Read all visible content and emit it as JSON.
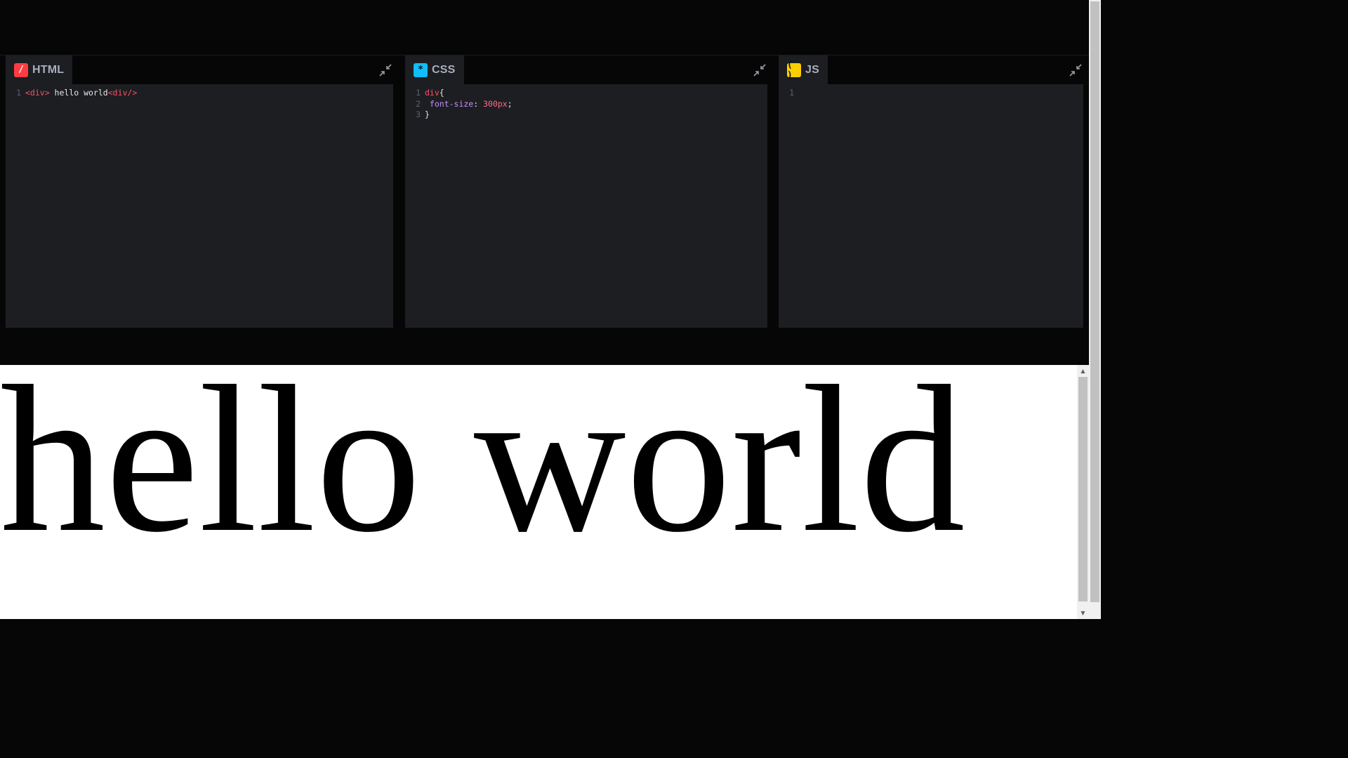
{
  "editors": {
    "html": {
      "icon_glyph": "/",
      "label": "HTML",
      "lines": [
        {
          "num": "1",
          "tokens": [
            {
              "t": "tag",
              "v": "<div>"
            },
            {
              "t": "txt",
              "v": " hello world"
            },
            {
              "t": "tag",
              "v": "<div/>"
            }
          ]
        }
      ]
    },
    "css": {
      "icon_glyph": "*",
      "label": "CSS",
      "lines": [
        {
          "num": "1",
          "tokens": [
            {
              "t": "sel",
              "v": "div"
            },
            {
              "t": "punct",
              "v": "{"
            }
          ]
        },
        {
          "num": "2",
          "tokens": [
            {
              "t": "prop",
              "v": " font-size"
            },
            {
              "t": "punct",
              "v": ": "
            },
            {
              "t": "num",
              "v": "300px"
            },
            {
              "t": "punct",
              "v": ";"
            }
          ]
        },
        {
          "num": "3",
          "tokens": [
            {
              "t": "punct",
              "v": "}"
            }
          ]
        }
      ]
    },
    "js": {
      "icon_glyph": "( )",
      "label": "JS",
      "lines": [
        {
          "num": "1",
          "tokens": []
        }
      ]
    }
  },
  "preview": {
    "text": "hello world"
  },
  "colors": {
    "html_icon": "#ff3c41",
    "css_icon": "#0ebeff",
    "js_icon": "#fcd000",
    "editor_bg": "#1d1e22",
    "page_bg": "#060606"
  },
  "icons": {
    "collapse": "collapse-arrows-icon"
  }
}
